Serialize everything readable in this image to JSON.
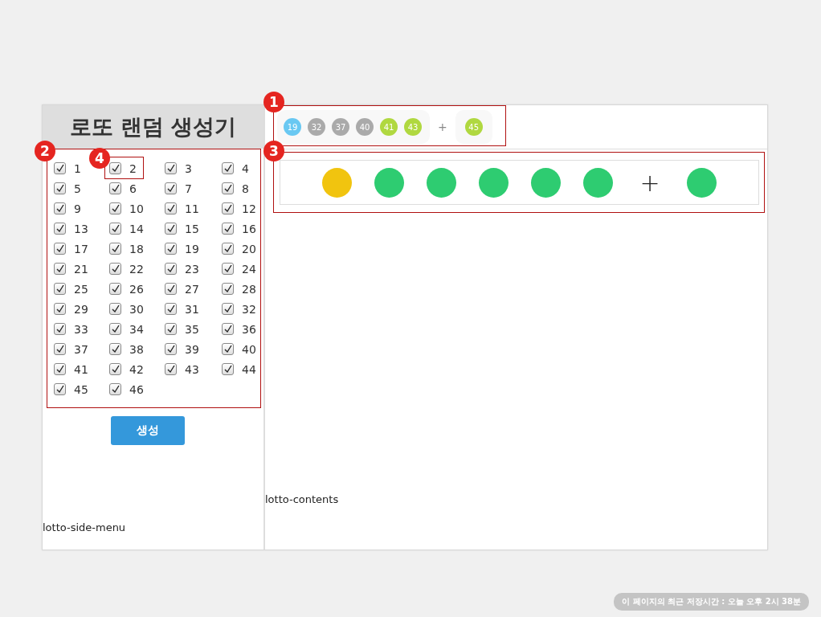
{
  "title": "로또 랜덤 생성기",
  "numbers": [
    {
      "label": "1",
      "checked": true
    },
    {
      "label": "2",
      "checked": true
    },
    {
      "label": "3",
      "checked": true
    },
    {
      "label": "4",
      "checked": true
    },
    {
      "label": "5",
      "checked": true
    },
    {
      "label": "6",
      "checked": true
    },
    {
      "label": "7",
      "checked": true
    },
    {
      "label": "8",
      "checked": true
    },
    {
      "label": "9",
      "checked": true
    },
    {
      "label": "10",
      "checked": true
    },
    {
      "label": "11",
      "checked": true
    },
    {
      "label": "12",
      "checked": true
    },
    {
      "label": "13",
      "checked": true
    },
    {
      "label": "14",
      "checked": true
    },
    {
      "label": "15",
      "checked": true
    },
    {
      "label": "16",
      "checked": true
    },
    {
      "label": "17",
      "checked": true
    },
    {
      "label": "18",
      "checked": true
    },
    {
      "label": "19",
      "checked": true
    },
    {
      "label": "20",
      "checked": true
    },
    {
      "label": "21",
      "checked": true
    },
    {
      "label": "22",
      "checked": true
    },
    {
      "label": "23",
      "checked": true
    },
    {
      "label": "24",
      "checked": true
    },
    {
      "label": "25",
      "checked": true
    },
    {
      "label": "26",
      "checked": true
    },
    {
      "label": "27",
      "checked": true
    },
    {
      "label": "28",
      "checked": true
    },
    {
      "label": "29",
      "checked": true
    },
    {
      "label": "30",
      "checked": true
    },
    {
      "label": "31",
      "checked": true
    },
    {
      "label": "32",
      "checked": true
    },
    {
      "label": "33",
      "checked": true
    },
    {
      "label": "34",
      "checked": true
    },
    {
      "label": "35",
      "checked": true
    },
    {
      "label": "36",
      "checked": true
    },
    {
      "label": "37",
      "checked": true
    },
    {
      "label": "38",
      "checked": true
    },
    {
      "label": "39",
      "checked": true
    },
    {
      "label": "40",
      "checked": true
    },
    {
      "label": "41",
      "checked": true
    },
    {
      "label": "42",
      "checked": true
    },
    {
      "label": "43",
      "checked": true
    },
    {
      "label": "44",
      "checked": true
    },
    {
      "label": "45",
      "checked": true
    },
    {
      "label": "46",
      "checked": true
    }
  ],
  "generate_button": "생성",
  "side_caption": "lotto-side-menu",
  "result_balls": [
    {
      "label": "19",
      "color": "#69c8f2"
    },
    {
      "label": "32",
      "color": "#aaaaaa"
    },
    {
      "label": "37",
      "color": "#aaaaaa"
    },
    {
      "label": "40",
      "color": "#aaaaaa"
    },
    {
      "label": "41",
      "color": "#b0d840"
    },
    {
      "label": "43",
      "color": "#b0d840"
    }
  ],
  "result_plus": "+",
  "result_bonus": {
    "label": "45",
    "color": "#b0d840"
  },
  "preview_balls": [
    {
      "color": "#f1c40f"
    },
    {
      "color": "#2ecc71"
    },
    {
      "color": "#2ecc71"
    },
    {
      "color": "#2ecc71"
    },
    {
      "color": "#2ecc71"
    },
    {
      "color": "#2ecc71"
    }
  ],
  "preview_plus": "+",
  "preview_bonus": {
    "color": "#2ecc71"
  },
  "content_caption": "lotto-contents",
  "annotations": [
    {
      "label": "1"
    },
    {
      "label": "2"
    },
    {
      "label": "4"
    },
    {
      "label": "3"
    }
  ],
  "save_notice": "이 페이지의 최근 저장시간 : 오늘 오후 2시 38분"
}
